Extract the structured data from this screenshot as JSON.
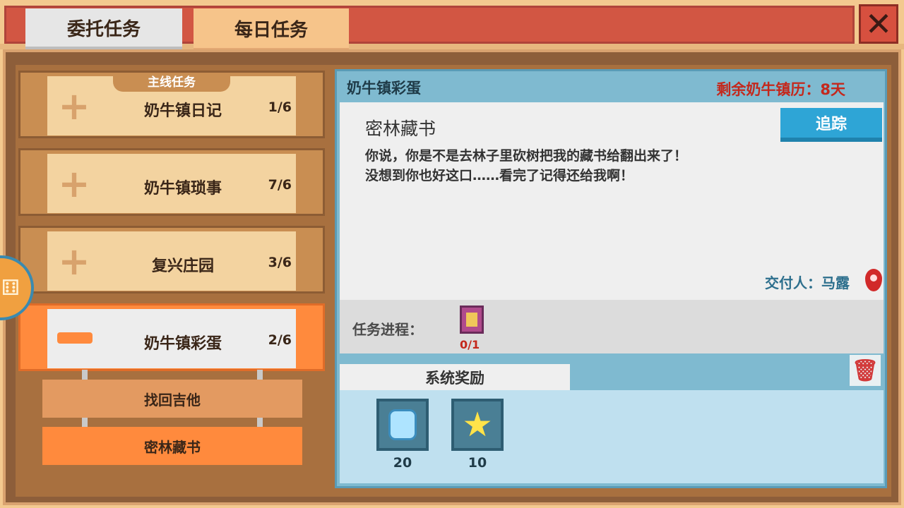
{
  "tabs": [
    {
      "label": "委托任务"
    },
    {
      "label": "每日任务"
    }
  ],
  "left": {
    "main_label": "主线任务",
    "quests": [
      {
        "name": "奶牛镇日记",
        "count": "1/6"
      },
      {
        "name": "奶牛镇琐事",
        "count": "7/6"
      },
      {
        "name": "复兴庄园",
        "count": "3/6"
      },
      {
        "name": "奶牛镇彩蛋",
        "count": "2/6"
      }
    ],
    "sub_quests": [
      {
        "name": "找回吉他"
      },
      {
        "name": "密林藏书"
      }
    ]
  },
  "detail": {
    "title": "奶牛镇彩蛋",
    "remaining": "剩余奶牛镇历：8天",
    "subtitle": "密林藏书",
    "description": "你说，你是不是去林子里砍树把我的藏书给翻出来了！\n没想到你也好这口……看完了记得还给我啊！",
    "track_button": "追踪",
    "deliver": "交付人：马露",
    "progress_label": "任务进程：",
    "progress_count": "0/1",
    "reward_tab": "系统奖励",
    "rewards": [
      {
        "icon": "gem-icon",
        "count": "20"
      },
      {
        "icon": "star-icon",
        "count": "10"
      }
    ]
  },
  "icons": {
    "close": "✕",
    "plus": "+",
    "trash": "🗑",
    "star": "★"
  },
  "colors": {
    "accent_orange": "#ff8a3d",
    "title_red": "#c4281c",
    "track_blue": "#2ea5d6"
  }
}
